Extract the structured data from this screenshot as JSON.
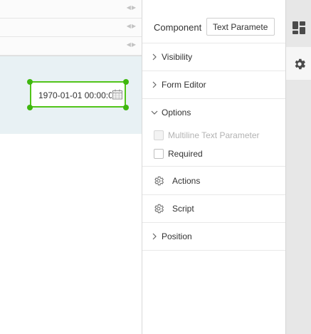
{
  "canvas": {
    "field_value": "1970-01-01 00:00:00",
    "ruler_arrows": "◀▶"
  },
  "panel": {
    "component_label": "Component",
    "component_value": "Text Parameter",
    "sections": {
      "visibility": "Visibility",
      "form_editor": "Form Editor",
      "options": "Options",
      "actions": "Actions",
      "script": "Script",
      "position": "Position"
    },
    "options": {
      "multiline_label": "Multiline Text Parameter",
      "multiline_disabled": true,
      "multiline_checked": false,
      "required_label": "Required",
      "required_checked": false
    }
  },
  "rail": {
    "tabs": [
      {
        "icon": "layout-grid-icon",
        "active": false
      },
      {
        "icon": "gear-icon",
        "active": true
      }
    ]
  },
  "colors": {
    "selection_green": "#52c41a",
    "stage_background": "#e8f1f4",
    "rail_background": "#e7e7e7"
  }
}
